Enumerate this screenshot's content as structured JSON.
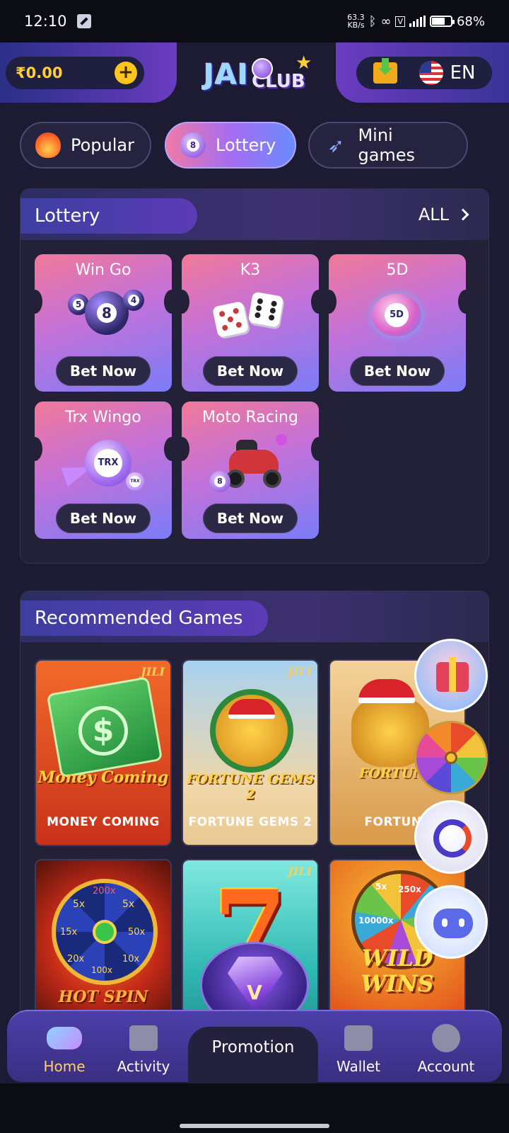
{
  "status_bar": {
    "time": "12:10",
    "net_speed_value": "63.3",
    "net_speed_unit": "KB/s",
    "battery": "68%",
    "battery_level": 0.68
  },
  "header": {
    "balance": "₹0.00",
    "logo_main": "JAI",
    "logo_sub": "CLUB",
    "language": "EN"
  },
  "tabs": [
    {
      "label": "Popular",
      "icon": "fire-icon",
      "active": false
    },
    {
      "label": "Lottery",
      "icon": "lottery-ball-icon",
      "icon_text": "8",
      "active": true
    },
    {
      "label": "Mini games",
      "icon": "rocket-icon",
      "active": false
    }
  ],
  "lottery": {
    "title": "Lottery",
    "all_label": "ALL",
    "games": [
      {
        "name": "Win Go",
        "button": "Bet Now",
        "balls": [
          "5",
          "8",
          "4"
        ]
      },
      {
        "name": "K3",
        "button": "Bet Now"
      },
      {
        "name": "5D",
        "button": "Bet Now",
        "ball": "5D"
      },
      {
        "name": "Trx Wingo",
        "button": "Bet Now",
        "ball": "TRX",
        "small_ball": "TRX"
      },
      {
        "name": "Moto Racing",
        "button": "Bet Now",
        "ball": "8"
      }
    ]
  },
  "recommended": {
    "title": "Recommended Games",
    "provider": "JILI",
    "games": [
      {
        "label": "MONEY COMING",
        "art_title": "Money Coming",
        "colors": [
          "#f26a2a",
          "#c8321a"
        ]
      },
      {
        "label": "FORTUNE GEMS 2",
        "art_title": "FORTUNE GEMS 2",
        "colors": [
          "#a8d2f0",
          "#e8c993"
        ]
      },
      {
        "label": "FORTUNE",
        "art_title": "FORTUNE",
        "colors": [
          "#f3d39a",
          "#d99a4b"
        ]
      },
      {
        "label": "",
        "art_title": "HOT SPIN",
        "wheel_labels": [
          "5x",
          "200x",
          "5x",
          "50x",
          "10x",
          "100x",
          "20x",
          "15x"
        ],
        "colors": [
          "#c42a18",
          "#320a06"
        ]
      },
      {
        "label": "",
        "art_title": "7",
        "colors": [
          "#7fe9e0",
          "#1f8a8c"
        ]
      },
      {
        "label": "",
        "art_title": "WILD WINS",
        "wheel_labels": [
          "10000x",
          "250x",
          "5x"
        ],
        "colors": [
          "#f9c235",
          "#e3541b"
        ]
      }
    ]
  },
  "floating": [
    {
      "name": "gift-float-button"
    },
    {
      "name": "lucky-wheel-float-button"
    },
    {
      "name": "dragon-float-button"
    },
    {
      "name": "support-bot-float-button"
    }
  ],
  "promo_badge": "V",
  "nav": {
    "home": "Home",
    "activity": "Activity",
    "promotion": "Promotion",
    "wallet": "Wallet",
    "account": "Account"
  },
  "colors": {
    "accent_gold": "#ffcf36",
    "active_nav": "#ffcf66",
    "panel": "#232138",
    "background": "#1d1b33"
  }
}
